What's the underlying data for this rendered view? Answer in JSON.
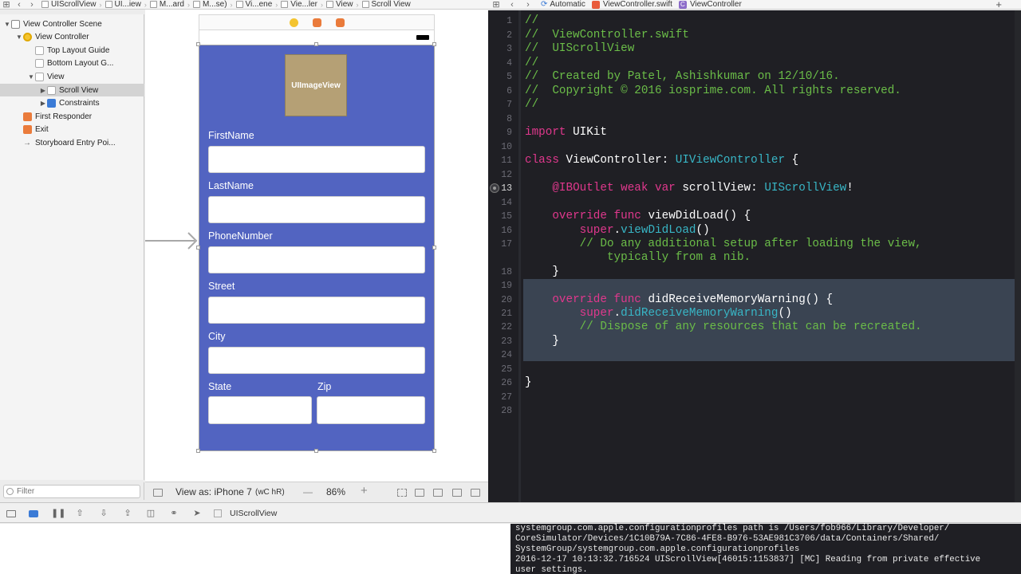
{
  "jumpbar_left": {
    "crumbs": [
      "UIScrollView",
      "UI...iew",
      "M...ard",
      "M...se)",
      "Vi...ene",
      "Vie...ler",
      "View",
      "Scroll View"
    ]
  },
  "jumpbar_right": {
    "mode": "Automatic",
    "file": "ViewController.swift",
    "symbol": "ViewController"
  },
  "outline": {
    "items": [
      {
        "label": "View Controller Scene",
        "icon": "scene-icon",
        "disclosure": "▼",
        "indent": 0
      },
      {
        "label": "View Controller",
        "icon": "view-controller-icon",
        "disclosure": "▼",
        "indent": 1
      },
      {
        "label": "Top Layout Guide",
        "icon": "layout-guide-icon",
        "disclosure": "",
        "indent": 2
      },
      {
        "label": "Bottom Layout G...",
        "icon": "layout-guide-icon",
        "disclosure": "",
        "indent": 2
      },
      {
        "label": "View",
        "icon": "view-icon",
        "disclosure": "▼",
        "indent": 2
      },
      {
        "label": "Scroll View",
        "icon": "scroll-view-icon",
        "disclosure": "▶",
        "indent": 3,
        "selected": true
      },
      {
        "label": "Constraints",
        "icon": "constraints-icon",
        "disclosure": "▶",
        "indent": 3
      },
      {
        "label": "First Responder",
        "icon": "first-responder-icon",
        "disclosure": "",
        "indent": 1
      },
      {
        "label": "Exit",
        "icon": "exit-icon",
        "disclosure": "",
        "indent": 1
      },
      {
        "label": "Storyboard Entry Poi...",
        "icon": "entry-arrow-icon",
        "disclosure": "",
        "indent": 1
      }
    ],
    "filter_placeholder": "Filter"
  },
  "canvas": {
    "image_view_label": "UIImageView",
    "labels": {
      "first_name": "FirstName",
      "last_name": "LastName",
      "phone": "PhoneNumber",
      "street": "Street",
      "city": "City",
      "state": "State",
      "zip": "Zip"
    },
    "phone_color": "#5264c1",
    "image_color": "#b5a075"
  },
  "canvas_bottom": {
    "view_as": "View as: iPhone 7",
    "size_class": "(wC hR)",
    "zoom": "86%"
  },
  "editor": {
    "lines": [
      {
        "n": "1",
        "parts": [
          [
            "c-comment",
            "//"
          ]
        ]
      },
      {
        "n": "2",
        "parts": [
          [
            "c-comment",
            "//  ViewController.swift"
          ]
        ]
      },
      {
        "n": "3",
        "parts": [
          [
            "c-comment",
            "//  UIScrollView"
          ]
        ]
      },
      {
        "n": "4",
        "parts": [
          [
            "c-comment",
            "//"
          ]
        ]
      },
      {
        "n": "5",
        "parts": [
          [
            "c-comment",
            "//  Created by Patel, Ashishkumar on 12/10/16."
          ]
        ]
      },
      {
        "n": "6",
        "parts": [
          [
            "c-comment",
            "//  Copyright © 2016 iosprime.com. All rights reserved."
          ]
        ]
      },
      {
        "n": "7",
        "parts": [
          [
            "c-comment",
            "//"
          ]
        ]
      },
      {
        "n": "8",
        "parts": []
      },
      {
        "n": "9",
        "parts": [
          [
            "c-kw",
            "import"
          ],
          [
            "c-plain",
            " UIKit"
          ]
        ]
      },
      {
        "n": "10",
        "parts": []
      },
      {
        "n": "11",
        "parts": [
          [
            "c-kw",
            "class"
          ],
          [
            "c-plain",
            " ViewController: "
          ],
          [
            "c-type",
            "UIViewController"
          ],
          [
            "c-plain",
            " {"
          ]
        ]
      },
      {
        "n": "12",
        "parts": []
      },
      {
        "n": "13",
        "parts": [
          [
            "c-plain",
            "    "
          ],
          [
            "c-kw",
            "@IBOutlet weak var"
          ],
          [
            "c-plain",
            " scrollView: "
          ],
          [
            "c-type",
            "UIScrollView"
          ],
          [
            "c-plain",
            "!"
          ]
        ],
        "current": true
      },
      {
        "n": "14",
        "parts": []
      },
      {
        "n": "15",
        "parts": [
          [
            "c-plain",
            "    "
          ],
          [
            "c-kw",
            "override func"
          ],
          [
            "c-plain",
            " viewDidLoad() {"
          ]
        ]
      },
      {
        "n": "16",
        "parts": [
          [
            "c-plain",
            "        "
          ],
          [
            "c-kw",
            "super"
          ],
          [
            "c-plain",
            "."
          ],
          [
            "c-method",
            "viewDidLoad"
          ],
          [
            "c-plain",
            "()"
          ]
        ]
      },
      {
        "n": "17",
        "parts": [
          [
            "c-plain",
            "        "
          ],
          [
            "c-comment",
            "// Do any additional setup after loading the view,"
          ]
        ]
      },
      {
        "n": "",
        "parts": [
          [
            "c-plain",
            "            "
          ],
          [
            "c-comment",
            "typically from a nib."
          ]
        ]
      },
      {
        "n": "18",
        "parts": [
          [
            "c-plain",
            "    }"
          ]
        ]
      },
      {
        "n": "19",
        "parts": []
      },
      {
        "n": "20",
        "parts": [
          [
            "c-plain",
            "    "
          ],
          [
            "c-kw",
            "override func"
          ],
          [
            "c-plain",
            " didReceiveMemoryWarning() {"
          ]
        ]
      },
      {
        "n": "21",
        "parts": [
          [
            "c-plain",
            "        "
          ],
          [
            "c-kw",
            "super"
          ],
          [
            "c-plain",
            "."
          ],
          [
            "c-method",
            "didReceiveMemoryWarning"
          ],
          [
            "c-plain",
            "()"
          ]
        ]
      },
      {
        "n": "22",
        "parts": [
          [
            "c-plain",
            "        "
          ],
          [
            "c-comment",
            "// Dispose of any resources that can be recreated."
          ]
        ]
      },
      {
        "n": "23",
        "parts": [
          [
            "c-plain",
            "    }"
          ]
        ]
      },
      {
        "n": "24",
        "parts": []
      },
      {
        "n": "25",
        "parts": []
      },
      {
        "n": "26",
        "parts": [
          [
            "c-plain",
            "}"
          ]
        ]
      },
      {
        "n": "27",
        "parts": []
      },
      {
        "n": "28",
        "parts": []
      }
    ]
  },
  "debug_bar": {
    "scheme": "UIScrollView"
  },
  "console": {
    "text": "systemgroup.com.apple.configurationprofiles path is /Users/fob966/Library/Developer/\nCoreSimulator/Devices/1C10B79A-7C86-4FE8-B976-53AE981C3706/data/Containers/Shared/\nSystemGroup/systemgroup.com.apple.configurationprofiles\n2016-12-17 10:13:32.716524 UIScrollView[46015:1153837] [MC] Reading from private effective\nuser settings."
  }
}
